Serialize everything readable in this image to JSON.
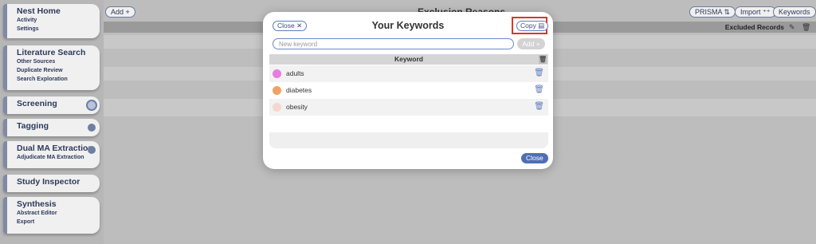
{
  "sidebar": {
    "sections": [
      {
        "title": "Nest Home",
        "items": [
          "Activity",
          "Settings"
        ]
      },
      {
        "title": "Literature Search",
        "items": [
          "Other Sources",
          "Duplicate Review",
          "Search Exploration"
        ]
      },
      {
        "title": "Screening",
        "items": []
      },
      {
        "title": "Tagging",
        "items": []
      },
      {
        "title": "Dual MA Extraction",
        "items": [
          "Adjudicate MA Extraction"
        ]
      },
      {
        "title": "Study Inspector",
        "items": []
      },
      {
        "title": "Synthesis",
        "items": [
          "Abstract Editor",
          "Export"
        ]
      }
    ]
  },
  "background": {
    "add_label": "Add +",
    "title": "Exclusion Reasons",
    "prisma_label": "PRISMA ⇅",
    "import_label": "Import ⁺⁺",
    "keywords_label": "Keywords",
    "excluded_records_label": "Excluded Records"
  },
  "modal": {
    "title": "Your Keywords",
    "close_label": "Close ✕",
    "copy_label": "Copy ▤",
    "input_placeholder": "New keyword",
    "input_value": "",
    "add_label": "Add +",
    "table_header": "Keyword",
    "keywords": [
      {
        "label": "adults",
        "color": "#e57ee0"
      },
      {
        "label": "diabetes",
        "color": "#f0a266"
      },
      {
        "label": "obesity",
        "color": "#f5d7d0"
      }
    ],
    "close_bottom_label": "Close"
  },
  "colors": {
    "accent": "#4f6fb3",
    "highlight": "#d9362c"
  }
}
